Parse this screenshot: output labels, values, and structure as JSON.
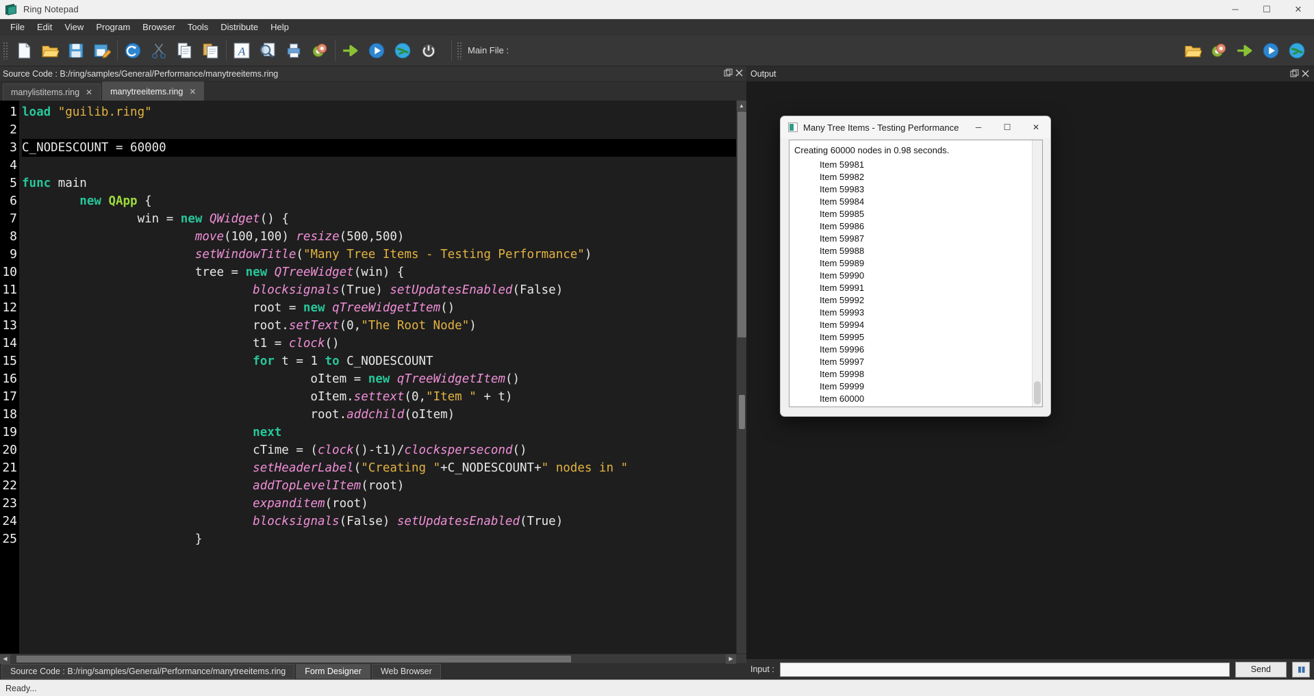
{
  "window": {
    "title": "Ring Notepad",
    "app_icon": "ring-notepad-icon",
    "controls": {
      "minimize": "─",
      "maximize": "☐",
      "close": "✕"
    }
  },
  "menubar": {
    "items": [
      "File",
      "Edit",
      "View",
      "Program",
      "Browser",
      "Tools",
      "Distribute",
      "Help"
    ]
  },
  "toolbar": {
    "left_icons": [
      "new-file-icon",
      "open-folder-icon",
      "save-icon",
      "save-as-icon",
      "undo-icon",
      "cut-icon",
      "copy-icon",
      "paste-icon",
      "font-icon",
      "find-icon",
      "print-icon",
      "settings-gear-icon",
      "goto-arrow-icon",
      "run-play-icon",
      "web-globe-icon",
      "power-icon"
    ],
    "main_file_label": "Main File :",
    "right_icons": [
      "open-folder-icon",
      "settings-gear-icon",
      "goto-arrow-icon",
      "run-play-icon",
      "web-globe-icon"
    ]
  },
  "source_pane": {
    "header": "Source Code : B:/ring/samples/General/Performance/manytreeitems.ring",
    "float_button": "float-pane-icon",
    "close_button": "close-pane-icon",
    "tabs": [
      {
        "label": "manylistitems.ring",
        "close": "✕",
        "active": false
      },
      {
        "label": "manytreeitems.ring",
        "close": "✕",
        "active": true
      }
    ],
    "bottom_tabs": [
      {
        "label": "Source Code : B:/ring/samples/General/Performance/manytreeitems.ring",
        "active": true
      },
      {
        "label": "Form Designer",
        "active": false
      },
      {
        "label": "Web Browser",
        "active": false
      }
    ]
  },
  "editor": {
    "first_line": 1,
    "current_line": 3,
    "line_numbers": [
      1,
      2,
      3,
      4,
      5,
      6,
      7,
      8,
      9,
      10,
      11,
      12,
      13,
      14,
      15,
      16,
      17,
      18,
      19,
      20,
      21,
      22,
      23,
      24,
      25
    ],
    "lines": [
      [
        {
          "t": "load",
          "c": "kw"
        },
        {
          "t": " ",
          "c": "pl"
        },
        {
          "t": "\"guilib.ring\"",
          "c": "str"
        }
      ],
      [],
      [
        {
          "t": "C_NODESCOUNT = 60000",
          "c": "pl"
        }
      ],
      [],
      [
        {
          "t": "func",
          "c": "kw"
        },
        {
          "t": " main",
          "c": "pl"
        }
      ],
      [
        {
          "t": "        ",
          "c": "pl"
        },
        {
          "t": "new",
          "c": "kw"
        },
        {
          "t": " ",
          "c": "pl"
        },
        {
          "t": "QApp",
          "c": "cls"
        },
        {
          "t": " {",
          "c": "pl"
        }
      ],
      [
        {
          "t": "                win = ",
          "c": "pl"
        },
        {
          "t": "new",
          "c": "kw"
        },
        {
          "t": " ",
          "c": "pl"
        },
        {
          "t": "QWidget",
          "c": "fn"
        },
        {
          "t": "() {",
          "c": "pl"
        }
      ],
      [
        {
          "t": "                        ",
          "c": "pl"
        },
        {
          "t": "move",
          "c": "fn"
        },
        {
          "t": "(100,100) ",
          "c": "pl"
        },
        {
          "t": "resize",
          "c": "fn"
        },
        {
          "t": "(500,500)",
          "c": "pl"
        }
      ],
      [
        {
          "t": "                        ",
          "c": "pl"
        },
        {
          "t": "setWindowTitle",
          "c": "fn"
        },
        {
          "t": "(",
          "c": "pl"
        },
        {
          "t": "\"Many Tree Items - Testing Performance\"",
          "c": "str"
        },
        {
          "t": ")",
          "c": "pl"
        }
      ],
      [
        {
          "t": "                        tree = ",
          "c": "pl"
        },
        {
          "t": "new",
          "c": "kw"
        },
        {
          "t": " ",
          "c": "pl"
        },
        {
          "t": "QTreeWidget",
          "c": "fn"
        },
        {
          "t": "(win) {",
          "c": "pl"
        }
      ],
      [
        {
          "t": "                                ",
          "c": "pl"
        },
        {
          "t": "blocksignals",
          "c": "fn"
        },
        {
          "t": "(True) ",
          "c": "pl"
        },
        {
          "t": "setUpdatesEnabled",
          "c": "fn"
        },
        {
          "t": "(False)",
          "c": "pl"
        }
      ],
      [
        {
          "t": "                                root = ",
          "c": "pl"
        },
        {
          "t": "new",
          "c": "kw"
        },
        {
          "t": " ",
          "c": "pl"
        },
        {
          "t": "qTreeWidgetItem",
          "c": "fn"
        },
        {
          "t": "()",
          "c": "pl"
        }
      ],
      [
        {
          "t": "                                root.",
          "c": "pl"
        },
        {
          "t": "setText",
          "c": "fn"
        },
        {
          "t": "(0,",
          "c": "pl"
        },
        {
          "t": "\"The Root Node\"",
          "c": "str"
        },
        {
          "t": ")",
          "c": "pl"
        }
      ],
      [
        {
          "t": "                                t1 = ",
          "c": "pl"
        },
        {
          "t": "clock",
          "c": "fn"
        },
        {
          "t": "()",
          "c": "pl"
        }
      ],
      [
        {
          "t": "                                ",
          "c": "pl"
        },
        {
          "t": "for",
          "c": "kw"
        },
        {
          "t": " t = 1 ",
          "c": "pl"
        },
        {
          "t": "to",
          "c": "kw"
        },
        {
          "t": " C_NODESCOUNT",
          "c": "pl"
        }
      ],
      [
        {
          "t": "                                        oItem = ",
          "c": "pl"
        },
        {
          "t": "new",
          "c": "kw"
        },
        {
          "t": " ",
          "c": "pl"
        },
        {
          "t": "qTreeWidgetItem",
          "c": "fn"
        },
        {
          "t": "()",
          "c": "pl"
        }
      ],
      [
        {
          "t": "                                        oItem.",
          "c": "pl"
        },
        {
          "t": "settext",
          "c": "fn"
        },
        {
          "t": "(0,",
          "c": "pl"
        },
        {
          "t": "\"Item \"",
          "c": "str"
        },
        {
          "t": " + t)",
          "c": "pl"
        }
      ],
      [
        {
          "t": "                                        root.",
          "c": "pl"
        },
        {
          "t": "addchild",
          "c": "fn"
        },
        {
          "t": "(oItem)",
          "c": "pl"
        }
      ],
      [
        {
          "t": "                                ",
          "c": "pl"
        },
        {
          "t": "next",
          "c": "kw"
        }
      ],
      [
        {
          "t": "                                cTime = (",
          "c": "pl"
        },
        {
          "t": "clock",
          "c": "fn"
        },
        {
          "t": "()-t1)/",
          "c": "pl"
        },
        {
          "t": "clockspersecond",
          "c": "fn"
        },
        {
          "t": "()",
          "c": "pl"
        }
      ],
      [
        {
          "t": "                                ",
          "c": "pl"
        },
        {
          "t": "setHeaderLabel",
          "c": "fn"
        },
        {
          "t": "(",
          "c": "pl"
        },
        {
          "t": "\"Creating \"",
          "c": "str"
        },
        {
          "t": "+C_NODESCOUNT+",
          "c": "pl"
        },
        {
          "t": "\" nodes in \"",
          "c": "str"
        }
      ],
      [
        {
          "t": "                                ",
          "c": "pl"
        },
        {
          "t": "addTopLevelItem",
          "c": "fn"
        },
        {
          "t": "(root)",
          "c": "pl"
        }
      ],
      [
        {
          "t": "                                ",
          "c": "pl"
        },
        {
          "t": "expanditem",
          "c": "fn"
        },
        {
          "t": "(root)",
          "c": "pl"
        }
      ],
      [
        {
          "t": "                                ",
          "c": "pl"
        },
        {
          "t": "blocksignals",
          "c": "fn"
        },
        {
          "t": "(False) ",
          "c": "pl"
        },
        {
          "t": "setUpdatesEnabled",
          "c": "fn"
        },
        {
          "t": "(True)",
          "c": "pl"
        }
      ],
      [
        {
          "t": "                        }",
          "c": "pl"
        }
      ]
    ]
  },
  "output_pane": {
    "header": "Output",
    "float_button": "float-pane-icon",
    "close_button": "close-pane-icon",
    "input_label": "Input :",
    "input_value": "",
    "send_label": "Send",
    "stop_icon": "stop-icon"
  },
  "dialog": {
    "title": "Many Tree Items - Testing Performance",
    "icon": "ring-app-icon",
    "controls": {
      "minimize": "─",
      "maximize": "☐",
      "close": "✕"
    },
    "tree_header": "Creating 60000 nodes in 0.98 seconds.",
    "tree_items": [
      "Item 59981",
      "Item 59982",
      "Item 59983",
      "Item 59984",
      "Item 59985",
      "Item 59986",
      "Item 59987",
      "Item 59988",
      "Item 59989",
      "Item 59990",
      "Item 59991",
      "Item 59992",
      "Item 59993",
      "Item 59994",
      "Item 59995",
      "Item 59996",
      "Item 59997",
      "Item 59998",
      "Item 59999",
      "Item 60000"
    ]
  },
  "statusbar": {
    "text": "Ready..."
  },
  "colors": {
    "keyword": "#27c79a",
    "class": "#9ddb3b",
    "function": "#f08fd8",
    "string": "#e3b341",
    "editor_bg": "#1e1e1e",
    "chrome_bg": "#373737",
    "accent": "#2e9b87"
  }
}
